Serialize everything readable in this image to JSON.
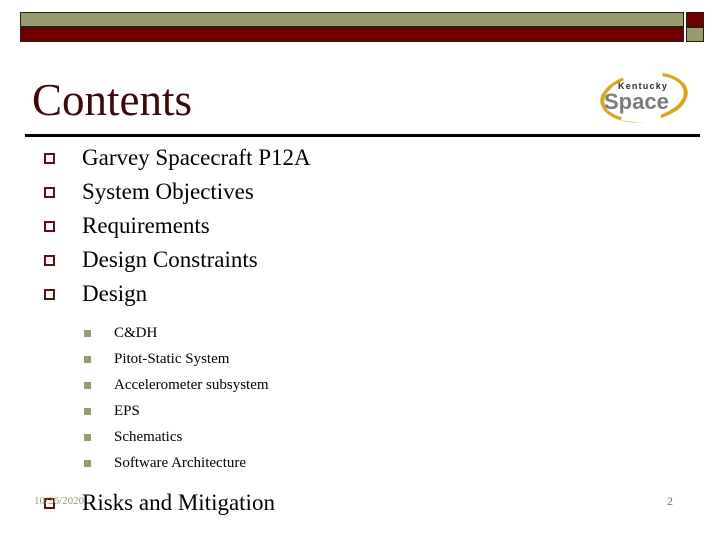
{
  "slide": {
    "title": "Contents",
    "colors": {
      "olive": "#9a9b6e",
      "maroon": "#6d0000",
      "title_text": "#3d0a0a",
      "bullet_level1": "#5d0f14",
      "bullet_level2": "#9a9b6e",
      "body_text": "#000000",
      "footer_text": "#9a9b6e"
    }
  },
  "logo": {
    "line1": "Kentucky",
    "line2": "Space",
    "swoosh_color": "#d7a71f",
    "word_color": "#7b7b7b"
  },
  "outline": {
    "level1": [
      {
        "label": "Garvey Spacecraft P12A",
        "bullet": "hollow-square-bullet"
      },
      {
        "label": "System Objectives",
        "bullet": "hollow-square-bullet"
      },
      {
        "label": "Requirements",
        "bullet": "hollow-square-bullet"
      },
      {
        "label": "Design Constraints",
        "bullet": "hollow-square-bullet"
      },
      {
        "label": "Design",
        "bullet": "hollow-square-bullet"
      }
    ],
    "level2": [
      {
        "label": "C&DH",
        "bullet": "filled-square-bullet"
      },
      {
        "label": "Pitot-Static System",
        "bullet": "filled-square-bullet"
      },
      {
        "label": "Accelerometer subsystem",
        "bullet": "filled-square-bullet"
      },
      {
        "label": "EPS",
        "bullet": "filled-square-bullet"
      },
      {
        "label": "Schematics",
        "bullet": "filled-square-bullet"
      },
      {
        "label": "Software Architecture",
        "bullet": "filled-square-bullet"
      }
    ],
    "last": {
      "label": "Risks and Mitigation",
      "bullet": "hollow-square-bullet"
    }
  },
  "footer": {
    "date": "10/26/2020",
    "page_number": "2"
  }
}
